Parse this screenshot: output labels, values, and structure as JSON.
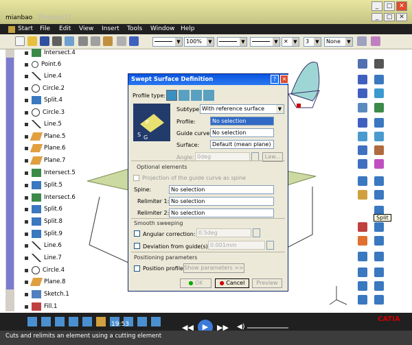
{
  "window": {
    "app_title": "mianbao",
    "title_suffix": "[Product1]",
    "buttons": [
      "_",
      "□",
      "✕"
    ],
    "inner_buttons": [
      "_",
      "□",
      "✕"
    ]
  },
  "menu": [
    "Start",
    "File",
    "Edit",
    "View",
    "Insert",
    "Tools",
    "Window",
    "Help"
  ],
  "toolbar": {
    "zoom": "100%",
    "layer": "None",
    "small_value": "3"
  },
  "tree": [
    {
      "label": "Intersect.4",
      "icon": "intersect"
    },
    {
      "label": "Point.6",
      "icon": "point"
    },
    {
      "label": "Line.4",
      "icon": "line"
    },
    {
      "label": "Circle.2",
      "icon": "circle"
    },
    {
      "label": "Split.4",
      "icon": "split"
    },
    {
      "label": "Circle.3",
      "icon": "circle"
    },
    {
      "label": "Line.5",
      "icon": "line"
    },
    {
      "label": "Plane.5",
      "icon": "plane"
    },
    {
      "label": "Plane.6",
      "icon": "plane"
    },
    {
      "label": "Plane.7",
      "icon": "plane"
    },
    {
      "label": "Intersect.5",
      "icon": "intersect"
    },
    {
      "label": "Split.5",
      "icon": "split"
    },
    {
      "label": "Intersect.6",
      "icon": "intersect"
    },
    {
      "label": "Split.6",
      "icon": "split"
    },
    {
      "label": "Split.8",
      "icon": "split"
    },
    {
      "label": "Split.9",
      "icon": "split"
    },
    {
      "label": "Line.6",
      "icon": "line"
    },
    {
      "label": "Line.7",
      "icon": "line"
    },
    {
      "label": "Circle.4",
      "icon": "circle"
    },
    {
      "label": "Plane.8",
      "icon": "plane"
    },
    {
      "label": "Sketch.1",
      "icon": "sketch"
    },
    {
      "label": "Fill.1",
      "icon": "fill"
    }
  ],
  "tooltip": "Split",
  "dialog": {
    "title": "Swept Surface Definition",
    "profile_type_label": "Profile type:",
    "subtype_label": "Subtype:",
    "subtype_value": "With reference surface",
    "profile_label": "Profile:",
    "profile_value": "No selection",
    "guide_label": "Guide curve:",
    "guide_value": "No selection",
    "surface_label": "Surface:",
    "surface_value": "Default (mean plane)",
    "angle_label": "Angle:",
    "angle_value": "0deg",
    "law_button": "Law...",
    "optional_title": "Optional elements",
    "projection_label": "Projection of the guide curve as spine",
    "spine_label": "Spine:",
    "spine_value": "No selection",
    "relim1_label": "Relimiter 1:",
    "relim1_value": "No selection",
    "relim2_label": "Relimiter 2:",
    "relim2_value": "No selection",
    "smooth_title": "Smooth sweeping",
    "angular_label": "Angular correction:",
    "angular_value": "0.5deg",
    "deviation_label": "Deviation from guide(s):",
    "deviation_value": "0.001mm",
    "positioning_title": "Positioning parameters",
    "position_label": "Position profile",
    "show_params": "Show parameters >>",
    "ok": "OK",
    "cancel": "Cancel",
    "preview": "Preview"
  },
  "status": {
    "text": "Cuts and relimits an element using a cutting element",
    "time": "19:53"
  },
  "colors": {
    "title_bg": "#d8d69a",
    "dialog_title": "#0a55e0",
    "plane_fill": "#ccd9a0"
  }
}
